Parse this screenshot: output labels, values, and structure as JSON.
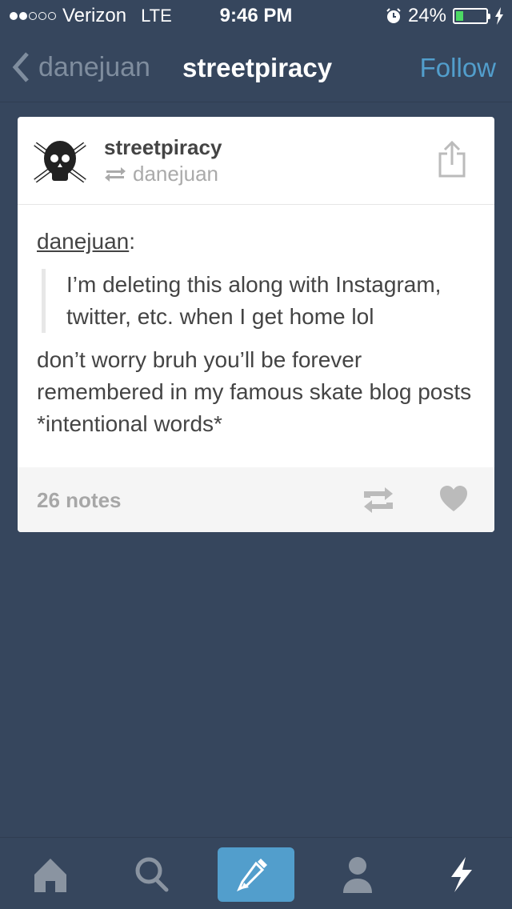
{
  "status_bar": {
    "signal_strength": "2 of 5",
    "carrier": "Verizon",
    "network": "LTE",
    "time": "9:46 PM",
    "alarm_icon": "alarm-clock-icon",
    "battery_percent": "24%",
    "battery_level": 0.24,
    "charging_icon": "bolt-icon"
  },
  "nav": {
    "back_label": "danejuan",
    "title": "streetpiracy",
    "follow_label": "Follow"
  },
  "post": {
    "blog_name": "streetpiracy",
    "reblogged_from": "danejuan",
    "source_user": "danejuan",
    "source_colon": ":",
    "quote": "I’m deleting this along with Instagram, twitter, etc. when I get home lol",
    "text": "don’t worry bruh you’ll be forever remembered in my famous skate blog posts *intentional words*",
    "notes": "26 notes"
  },
  "tab_bar": {
    "tabs": [
      {
        "name": "home",
        "icon": "home-icon"
      },
      {
        "name": "search",
        "icon": "search-icon"
      },
      {
        "name": "compose",
        "icon": "pencil-icon",
        "active": true
      },
      {
        "name": "account",
        "icon": "person-icon"
      },
      {
        "name": "activity",
        "icon": "lightning-icon"
      }
    ]
  },
  "colors": {
    "background": "#36465d",
    "accent": "#529ecc",
    "battery": "#4cd964"
  }
}
